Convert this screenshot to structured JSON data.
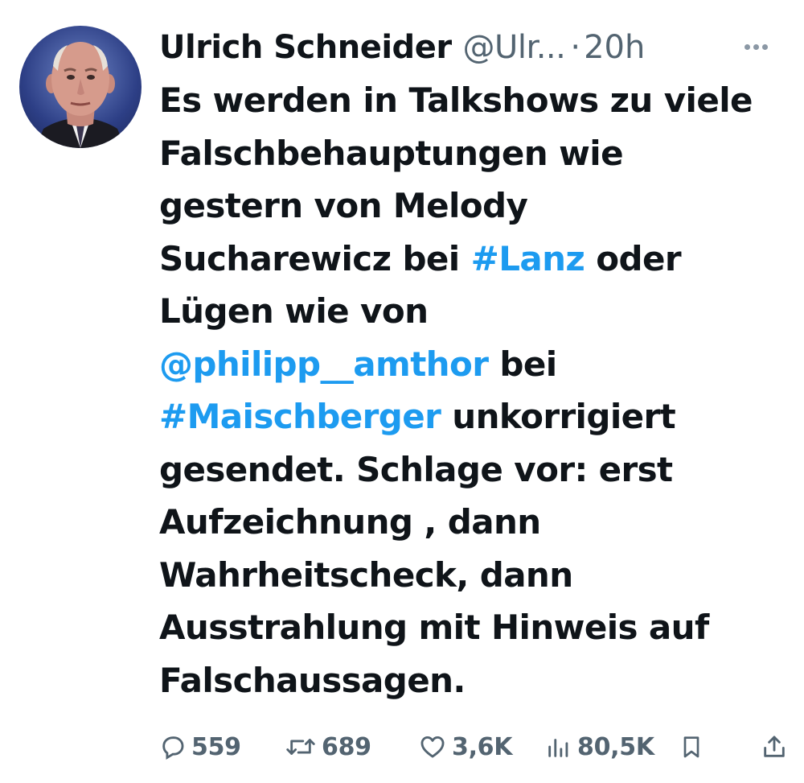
{
  "tweet": {
    "author": {
      "display_name": "Ulrich Schneider",
      "handle": "@Ulr...",
      "separator": "·",
      "time": "20h"
    },
    "text_lines": [
      [
        {
          "t": "Es werden in Talkshows zu viele",
          "link": false
        }
      ],
      [
        {
          "t": "Falschbehauptungen wie",
          "link": false
        }
      ],
      [
        {
          "t": "gestern von  Melody",
          "link": false
        }
      ],
      [
        {
          "t": "Sucharewicz bei ",
          "link": false
        },
        {
          "t": "#Lanz",
          "link": true
        },
        {
          "t": " oder",
          "link": false
        }
      ],
      [
        {
          "t": "Lügen wie von",
          "link": false
        }
      ],
      [
        {
          "t": "@philipp__amthor",
          "link": true
        },
        {
          "t": " bei",
          "link": false
        }
      ],
      [
        {
          "t": "#Maischberger",
          "link": true
        },
        {
          "t": " unkorrigiert",
          "link": false
        }
      ],
      [
        {
          "t": "gesendet. Schlage vor: erst",
          "link": false
        }
      ],
      [
        {
          "t": "Aufzeichnung , dann",
          "link": false
        }
      ],
      [
        {
          "t": "Wahrheitscheck, dann",
          "link": false
        }
      ],
      [
        {
          "t": "Ausstrahlung mit Hinweis auf",
          "link": false
        }
      ],
      [
        {
          "t": "Falschaussagen.",
          "link": false
        }
      ]
    ],
    "stats": {
      "replies": "559",
      "reposts": "689",
      "likes": "3,6K",
      "views": "80,5K"
    },
    "icons": {
      "more": "more-icon",
      "reply": "reply-icon",
      "repost": "repost-icon",
      "like": "like-icon",
      "views": "views-icon",
      "bookmark": "bookmark-icon",
      "share": "share-icon"
    },
    "colors": {
      "text": "#0f1419",
      "secondary": "#536471",
      "link": "#1d9bf0"
    }
  }
}
